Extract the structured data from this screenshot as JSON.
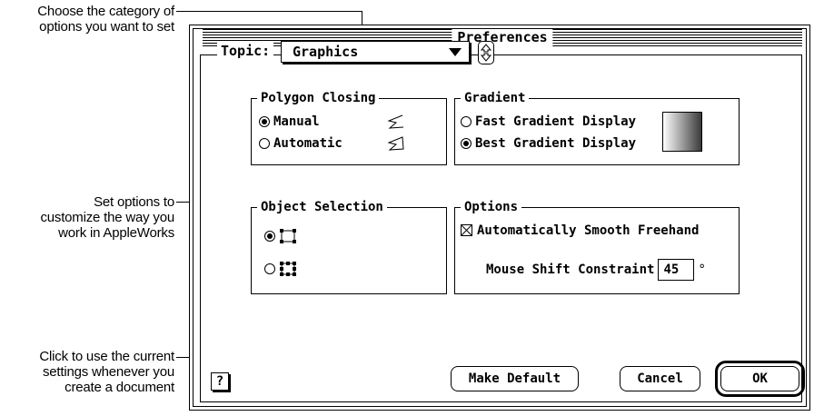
{
  "callouts": {
    "topic": [
      "Choose the category of",
      "options you want to set"
    ],
    "options": [
      "Set options to",
      "customize the way you",
      "work in AppleWorks"
    ],
    "default": [
      "Click to use the current",
      "settings whenever you",
      "create a document"
    ]
  },
  "window": {
    "title": "Preferences"
  },
  "topic": {
    "label": "Topic:",
    "value": "Graphics"
  },
  "polygon_closing": {
    "label": "Polygon Closing",
    "options": [
      {
        "label": "Manual",
        "selected": true
      },
      {
        "label": "Automatic",
        "selected": false
      }
    ]
  },
  "gradient": {
    "label": "Gradient",
    "options": [
      {
        "label": "Fast Gradient Display",
        "selected": false
      },
      {
        "label": "Best Gradient Display",
        "selected": true
      }
    ]
  },
  "object_selection": {
    "label": "Object Selection",
    "options": [
      {
        "handles": 4,
        "selected": true
      },
      {
        "handles": 8,
        "selected": false
      }
    ]
  },
  "options": {
    "label": "Options",
    "smooth_freehand": {
      "label": "Automatically Smooth Freehand",
      "checked": true
    },
    "mouse_shift": {
      "label": "Mouse Shift Constraint",
      "value": "45",
      "unit": "°"
    }
  },
  "buttons": {
    "help": "?",
    "make_default": "Make Default",
    "cancel": "Cancel",
    "ok": "OK"
  }
}
